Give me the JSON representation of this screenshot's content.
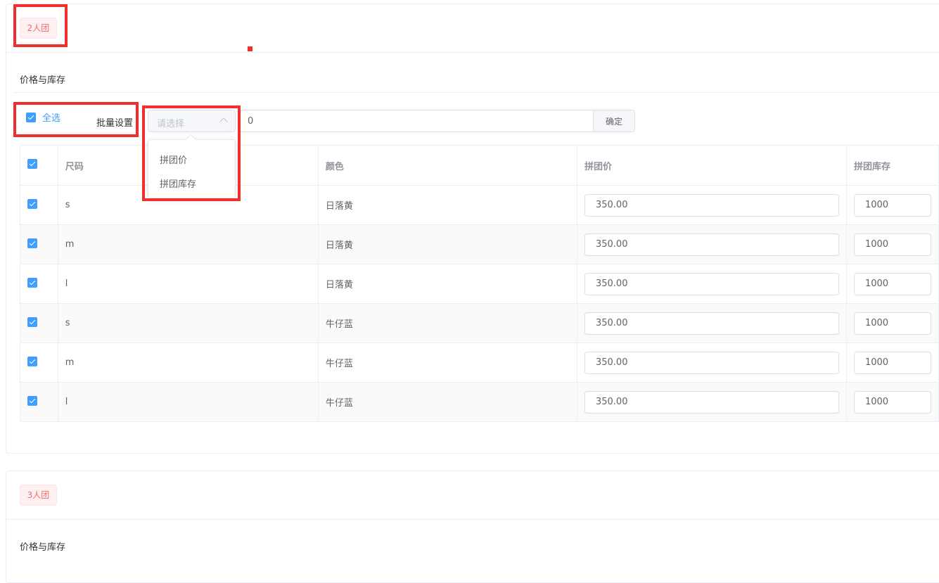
{
  "groups": [
    {
      "tag": "2人团",
      "section_title": "价格与库存",
      "batch": {
        "select_all_label": "全选",
        "batch_label": "批量设置",
        "select_placeholder": "请选择",
        "value": "0",
        "confirm_label": "确定",
        "options": [
          "拼团价",
          "拼团库存"
        ]
      },
      "table": {
        "columns": [
          "尺码",
          "颜色",
          "拼团价",
          "拼团库存"
        ],
        "rows": [
          {
            "size": "s",
            "color": "日落黄",
            "price": "350.00",
            "stock": "1000"
          },
          {
            "size": "m",
            "color": "日落黄",
            "price": "350.00",
            "stock": "1000"
          },
          {
            "size": "l",
            "color": "日落黄",
            "price": "350.00",
            "stock": "1000"
          },
          {
            "size": "s",
            "color": "牛仔蓝",
            "price": "350.00",
            "stock": "1000"
          },
          {
            "size": "m",
            "color": "牛仔蓝",
            "price": "350.00",
            "stock": "1000"
          },
          {
            "size": "l",
            "color": "牛仔蓝",
            "price": "350.00",
            "stock": "1000"
          }
        ]
      }
    },
    {
      "tag": "3人团",
      "section_title": "价格与库存"
    }
  ],
  "colors": {
    "accent": "#409eff",
    "tag_text": "#f56c6c",
    "tag_bg": "#fef0f0",
    "annotation": "#f02f2f"
  }
}
